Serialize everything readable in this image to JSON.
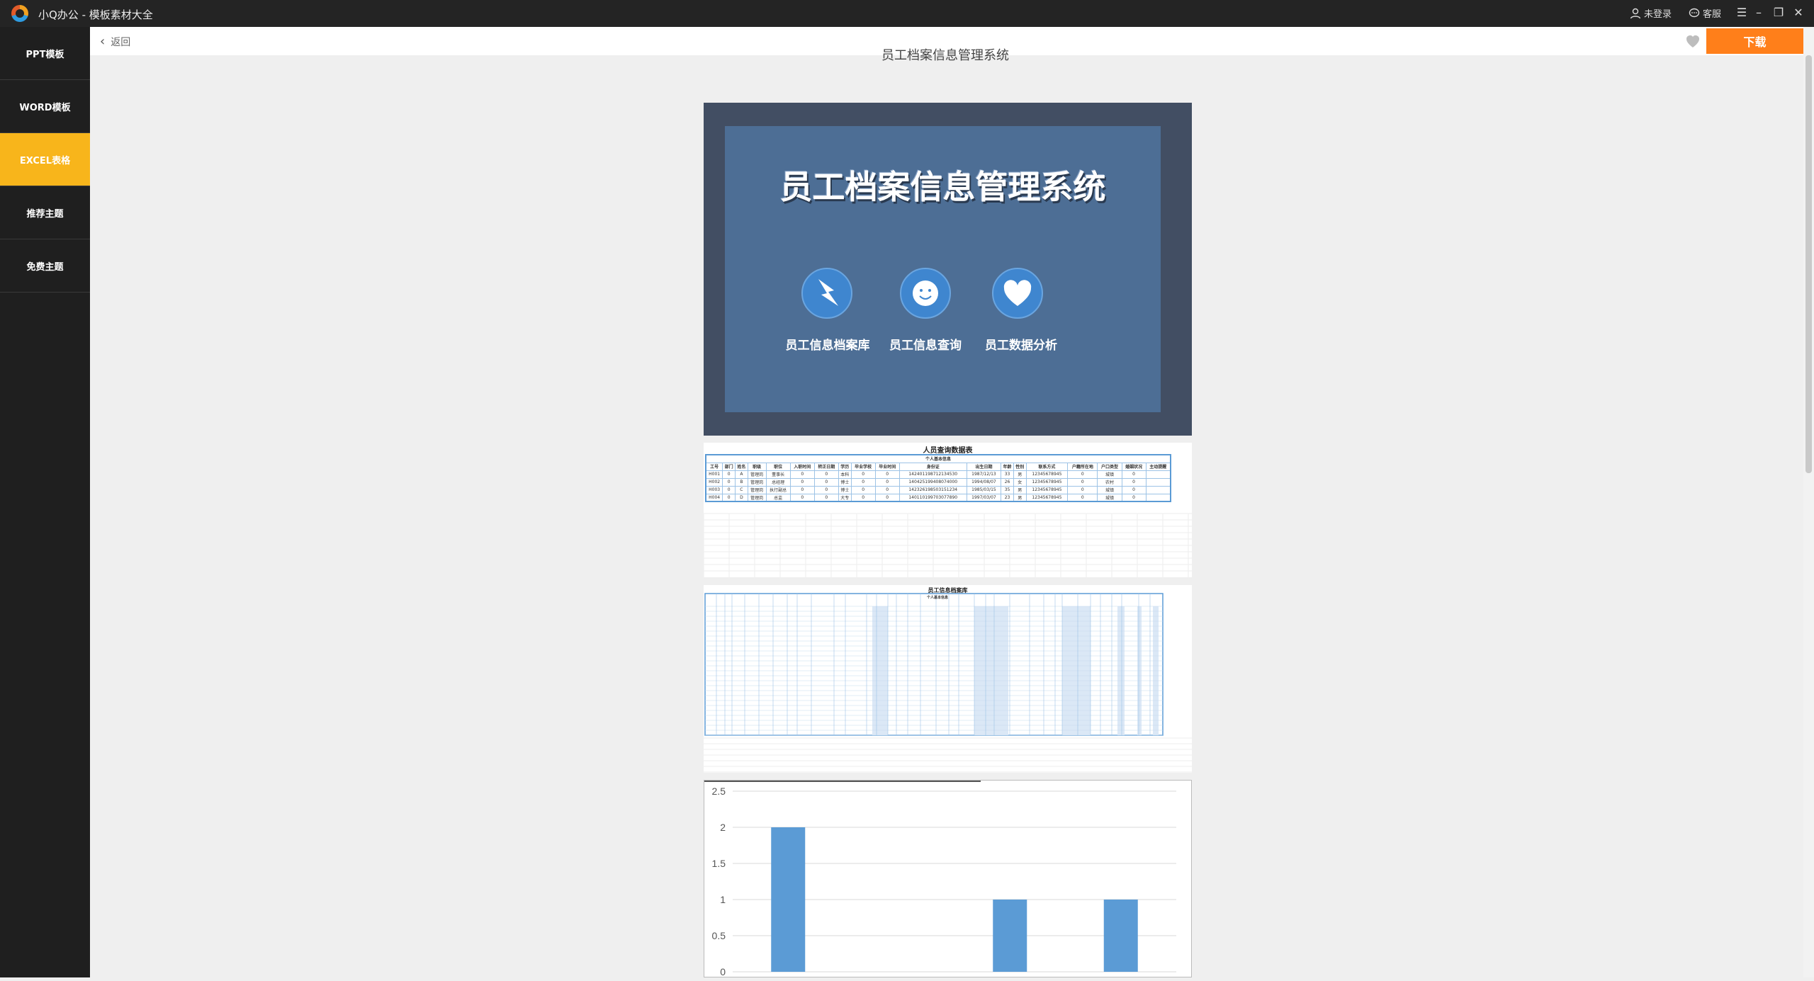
{
  "app": {
    "title": "小Q办公 - 模板素材大全"
  },
  "titlebar": {
    "login": "未登录",
    "service": "客服"
  },
  "sidebar": {
    "items": [
      {
        "label": "PPT模板"
      },
      {
        "label": "WORD模板"
      },
      {
        "label": "EXCEL表格"
      },
      {
        "label": "推荐主题"
      },
      {
        "label": "免费主题"
      }
    ]
  },
  "topbar": {
    "back": "返回",
    "download": "下载"
  },
  "page": {
    "heading": "员工档案信息管理系统"
  },
  "cover": {
    "title": "员工档案信息管理系统",
    "features": [
      {
        "label": "员工信息档案库",
        "icon": "lightning-icon"
      },
      {
        "label": "员工信息查询",
        "icon": "smiley-icon"
      },
      {
        "label": "员工数据分析",
        "icon": "heart-icon"
      }
    ]
  },
  "query_sheet": {
    "title": "人员查询数据表",
    "group_header": "个人基本信息",
    "columns": [
      "工号",
      "部门",
      "姓名",
      "职级",
      "职位",
      "入职时间",
      "转正日期",
      "学历",
      "毕业学校",
      "毕业时间",
      "身份证",
      "出生日期",
      "年龄",
      "性别",
      "联系方式",
      "户籍所在地",
      "户口类型",
      "婚姻状况",
      "主动提醒"
    ],
    "rows": [
      [
        "H001",
        "0",
        "A",
        "管理岗",
        "董事长",
        "0",
        "0",
        "本科",
        "0",
        "0",
        "142401198712134530",
        "1987/12/13",
        "33",
        "男",
        "12345678945",
        "0",
        "城镇",
        "0",
        ""
      ],
      [
        "H002",
        "0",
        "B",
        "管理岗",
        "总经理",
        "0",
        "0",
        "博士",
        "0",
        "0",
        "140425199408074000",
        "1994/08/07",
        "26",
        "女",
        "12345678945",
        "0",
        "农村",
        "0",
        ""
      ],
      [
        "H003",
        "0",
        "C",
        "管理岗",
        "执行副总",
        "0",
        "0",
        "博士",
        "0",
        "0",
        "142326198503151234",
        "1985/03/15",
        "35",
        "男",
        "12345678945",
        "0",
        "城镇",
        "0",
        ""
      ],
      [
        "H004",
        "0",
        "D",
        "管理岗",
        "总监",
        "0",
        "0",
        "大专",
        "0",
        "0",
        "140110199703077890",
        "1997/03/07",
        "23",
        "男",
        "12345678945",
        "0",
        "城镇",
        "0",
        ""
      ]
    ]
  },
  "archive_sheet": {
    "title": "员工信息档案库",
    "group_header": "个人基本信息"
  },
  "chart_data": {
    "type": "bar",
    "categories": [
      "",
      "",
      "",
      ""
    ],
    "values": [
      2,
      0,
      1,
      1
    ],
    "ylim": [
      0,
      2.5
    ],
    "yticks": [
      "0",
      "0.5",
      "1",
      "1.5",
      "2",
      "2.5"
    ],
    "bar_color": "#5b9bd5",
    "grid": true
  },
  "colors": {
    "accent": "#ff7f1a",
    "active_side": "#f8b51b",
    "sidebar": "#1f1f1f",
    "titlebar": "#242424"
  }
}
